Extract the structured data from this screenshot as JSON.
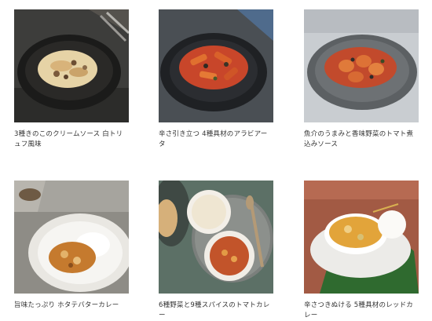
{
  "products": [
    {
      "image": "pasta-cream-mushroom-photo",
      "caption": "3種きのこのクリームソース 白トリュフ風味"
    },
    {
      "image": "penne-arrabbiata-photo",
      "caption": "辛さ引き立つ 4種具材のアラビアータ"
    },
    {
      "image": "fusilli-tomato-photo",
      "caption": "魚介のうまみと香味野菜のトマト煮込みソース"
    },
    {
      "image": "scallop-butter-curry-photo",
      "caption": "旨味たっぷり ホタテバターカレー"
    },
    {
      "image": "vegetable-tomato-curry-photo",
      "caption": "6種野菜と9種スパイスのトマトカレー"
    },
    {
      "image": "red-curry-photo",
      "caption": "辛さつきぬける 5種具材のレッドカレー"
    }
  ]
}
